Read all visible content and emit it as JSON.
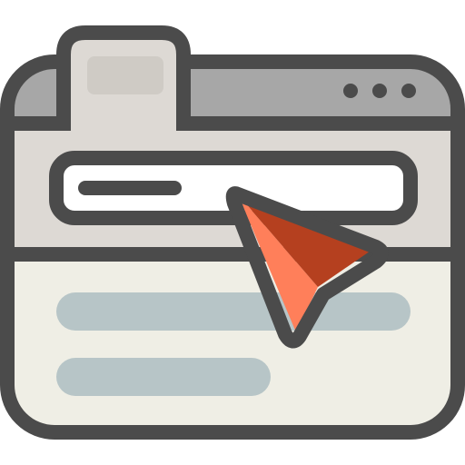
{
  "icon": {
    "name": "browser-window-search-cursor-icon",
    "colors": {
      "outline": "#4b4b4b",
      "titlebar": "#a7a7a7",
      "tab": "#ddd9d4",
      "tab_highlight": "#cfcbc5",
      "header_panel": "#ddd9d4",
      "search_box": "#ffffff",
      "content_panel": "#efeee5",
      "content_lines": "#b7c5c7",
      "cursor_light": "#ff7f5a",
      "cursor_dark": "#b5401f"
    }
  }
}
